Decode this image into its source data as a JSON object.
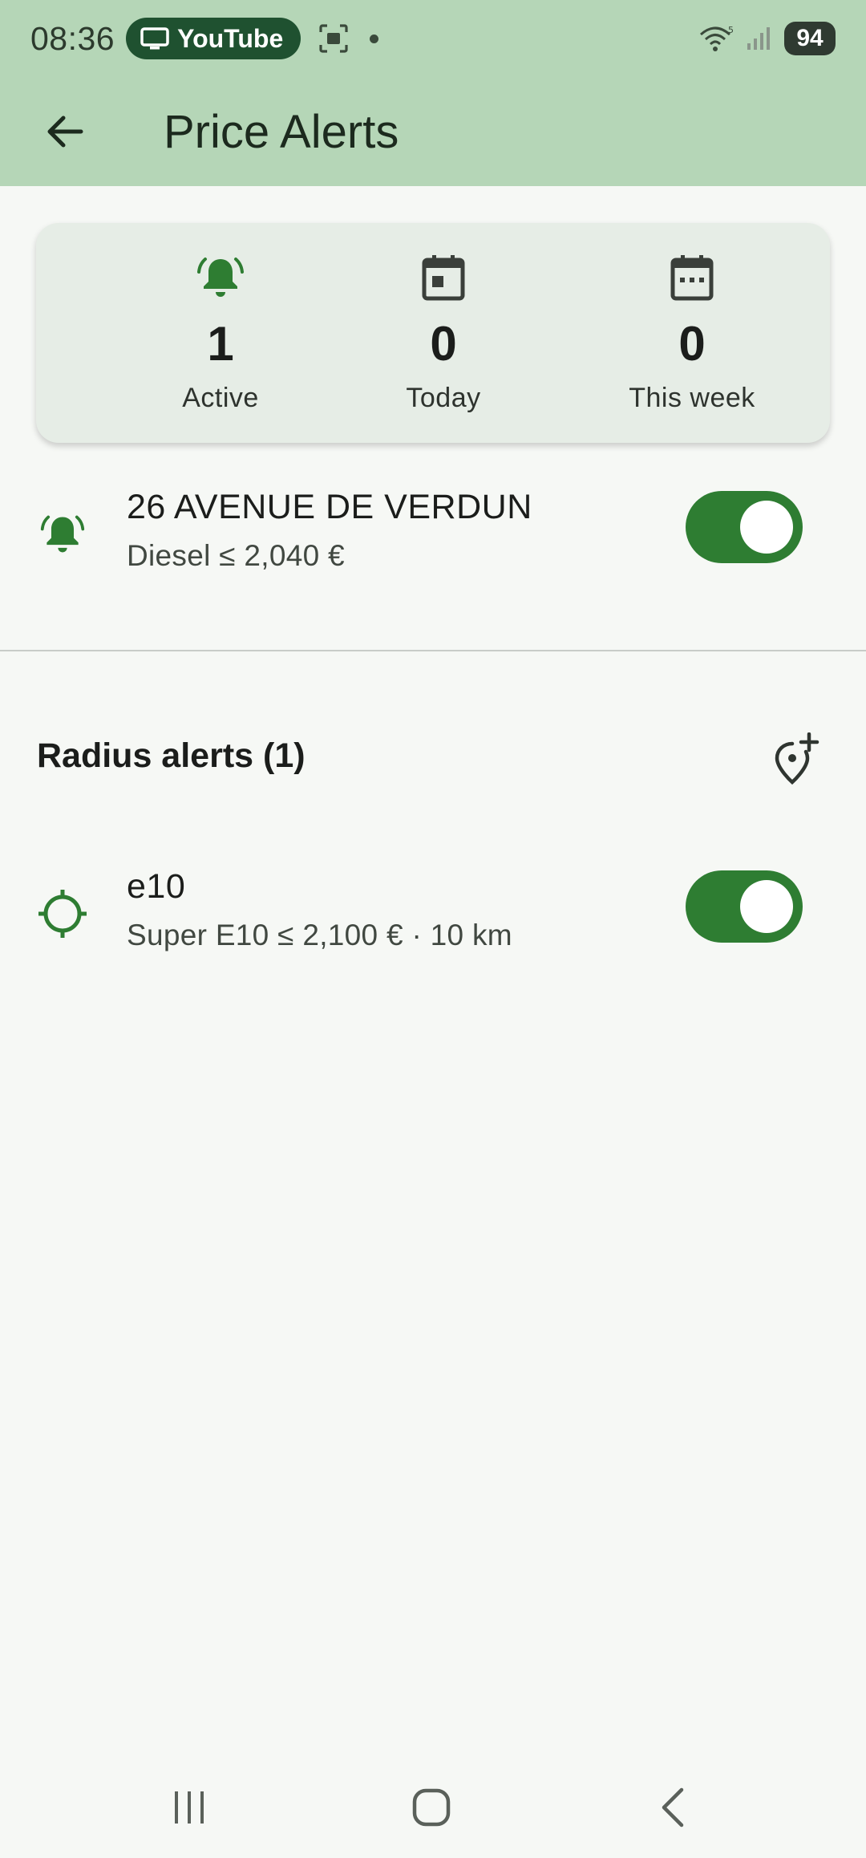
{
  "status_bar": {
    "time": "08:36",
    "cast_app": "YouTube",
    "battery": "94",
    "icons": [
      "cast-icon",
      "screenshot-icon",
      "wifi-icon",
      "signal-icon",
      "battery-icon"
    ]
  },
  "app_bar": {
    "title": "Price Alerts",
    "back_icon": "arrow-back-icon"
  },
  "stats": [
    {
      "icon": "bell-ringing-icon",
      "value": "1",
      "label": "Active",
      "color": "#2e7d32"
    },
    {
      "icon": "calendar-today-icon",
      "value": "0",
      "label": "Today",
      "color": "#3a3f3a"
    },
    {
      "icon": "calendar-week-icon",
      "value": "0",
      "label": "This week",
      "color": "#3a3f3a"
    }
  ],
  "station_alerts": [
    {
      "icon": "bell-ringing-icon",
      "title": "26 AVENUE DE VERDUN",
      "subtitle": "Diesel ≤ 2,040 €",
      "enabled": true
    }
  ],
  "radius_section": {
    "header": "Radius alerts (1)",
    "add_icon": "add-location-icon"
  },
  "radius_alerts": [
    {
      "icon": "gps-target-icon",
      "title": "e10",
      "subtitle": "Super E10 ≤ 2,100 € · 10 km",
      "enabled": true
    }
  ],
  "nav_bar": {
    "icons": [
      "recents-icon",
      "home-icon",
      "back-icon"
    ]
  },
  "colors": {
    "accent": "#2e7d32",
    "app_bar_bg": "#b5d6b7",
    "background": "#f6f8f5",
    "card_bg": "#e6ede6"
  }
}
